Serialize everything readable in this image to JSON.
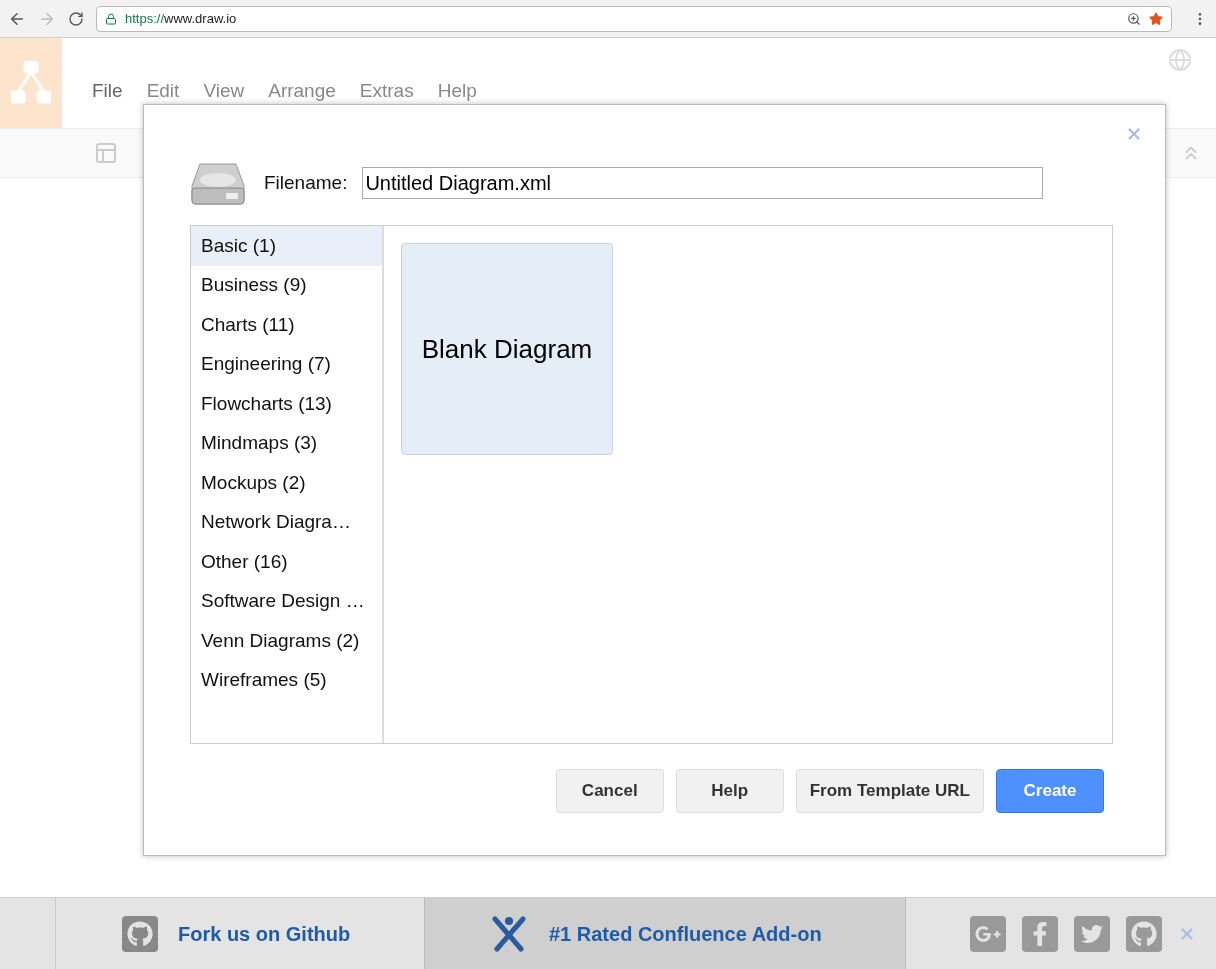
{
  "browser": {
    "url_scheme": "https://",
    "url_host": "www.draw.io"
  },
  "menu": [
    "File",
    "Edit",
    "View",
    "Arrange",
    "Extras",
    "Help"
  ],
  "dialog": {
    "filename_label": "Filename:",
    "filename_value": "Untitled Diagram.xml",
    "categories": [
      {
        "label": "Basic (1)",
        "selected": true
      },
      {
        "label": "Business (9)",
        "selected": false
      },
      {
        "label": "Charts (11)",
        "selected": false
      },
      {
        "label": "Engineering (7)",
        "selected": false
      },
      {
        "label": "Flowcharts (13)",
        "selected": false
      },
      {
        "label": "Mindmaps (3)",
        "selected": false
      },
      {
        "label": "Mockups (2)",
        "selected": false
      },
      {
        "label": "Network Diagra…",
        "selected": false
      },
      {
        "label": "Other (16)",
        "selected": false
      },
      {
        "label": "Software Design …",
        "selected": false
      },
      {
        "label": "Venn Diagrams (2)",
        "selected": false
      },
      {
        "label": "Wireframes (5)",
        "selected": false
      }
    ],
    "templates": [
      "Blank Diagram"
    ],
    "buttons": [
      {
        "label": "Cancel",
        "kind": "secondary"
      },
      {
        "label": "Help",
        "kind": "secondary"
      },
      {
        "label": "From Template URL",
        "kind": "secondary"
      },
      {
        "label": "Create",
        "kind": "primary"
      }
    ]
  },
  "footer": {
    "links": [
      "Fork us on Github",
      "#1 Rated Confluence Add-on"
    ]
  }
}
